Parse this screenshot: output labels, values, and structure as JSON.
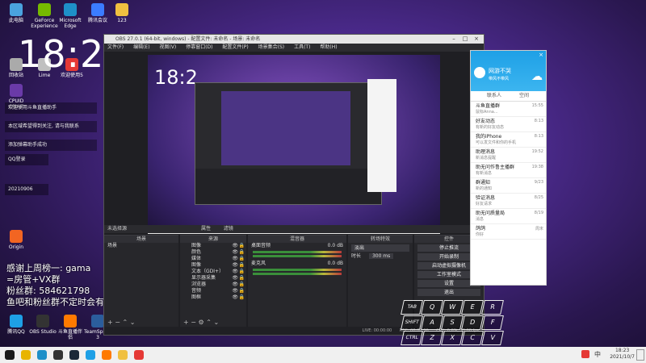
{
  "desktop": {
    "icons": [
      {
        "label": "此电脑",
        "color": "#4aa3df"
      },
      {
        "label": "GeForce Experience",
        "color": "#76b900"
      },
      {
        "label": "Microsoft Edge",
        "color": "#1e90c8"
      },
      {
        "label": "腾讯会议",
        "color": "#3b7cff"
      },
      {
        "label": "123",
        "color": "#f0c040"
      },
      {
        "label": "回收站",
        "color": "#aaaaaa"
      },
      {
        "label": "CPUID CPU-Z",
        "color": "#6a3aa8"
      },
      {
        "label": "Lime",
        "color": "#c0c0c0"
      },
      {
        "label": "欢迎使用5",
        "color": "#e53935"
      },
      {
        "label": "Origin",
        "color": "#f26522"
      },
      {
        "label": "腾讯QQ",
        "color": "#1ea0e6"
      },
      {
        "label": "OBS Studio",
        "color": "#333333"
      },
      {
        "label": "斗鱼直播伴侣",
        "color": "#ff7a00"
      },
      {
        "label": "TeamSpeak 3",
        "color": "#2b5d9c"
      }
    ],
    "big_clock": "18:2",
    "notifications": [
      "欢迎使用斗鱼直播助手",
      "本区域希望得到关注, 请与我联系",
      "添加弹幕助手成功",
      "QQ登录",
      "20210906"
    ],
    "overlay_lines": [
      "感谢上周榜一: gama",
      "=房管+VX群",
      "粉丝群: 584621798",
      "鱼吧和粉丝群不定时会有教学视频和天赋"
    ]
  },
  "obs": {
    "title": "OBS 27.0.1 (64-bit, windows) - 配置文件: 未命名 - 场景: 未命名",
    "menu": [
      "文件(F)",
      "编辑(E)",
      "视图(V)",
      "停靠窗口(D)",
      "配置文件(P)",
      "场景集合(S)",
      "工具(T)",
      "帮助(H)"
    ],
    "source_toolbar": {
      "no_source": "未选择源",
      "properties": "属性",
      "filters": "滤镜"
    },
    "docks": {
      "scenes": {
        "title": "场景",
        "items": [
          "场景"
        ]
      },
      "sources": {
        "title": "来源",
        "items": [
          "图像",
          "颜色",
          "媒体",
          "图像",
          "文本（GDI+）",
          "显示器采集",
          "浏览器",
          "音频",
          "图框"
        ]
      },
      "mixer": {
        "title": "混音器",
        "tracks": [
          {
            "name": "桌面音频",
            "db": "0.0 dB"
          },
          {
            "name": "麦克风",
            "db": "0.0 dB"
          }
        ]
      },
      "transitions": {
        "title": "转场特效",
        "type": "淡出",
        "duration_label": "时长",
        "duration": "300 ms"
      },
      "controls": {
        "title": "控件",
        "buttons": [
          "停止推流",
          "开始录制",
          "启动虚拟摄像机",
          "工作室模式",
          "设置",
          "退出"
        ]
      }
    },
    "status": {
      "live": "LIVE: 00:00:00",
      "rec": "REC: 00:00:00",
      "cpu": "CPU: 0.0%, 30.00 fps"
    }
  },
  "qq": {
    "name": "网游不哭",
    "signature": "带风不带风",
    "tabs": [
      "联系人",
      "空间"
    ],
    "chats": [
      {
        "title": "斗鱼直播群",
        "msg": "鼠标Anna...",
        "time": "15:55"
      },
      {
        "title": "好友动态",
        "msg": "有新的好友动态",
        "time": "8:13"
      },
      {
        "title": "我的iPhone",
        "msg": "可以发文件和你的手机",
        "time": "8:13"
      },
      {
        "title": "助理消息",
        "msg": "新消息提醒",
        "time": "19:52"
      },
      {
        "title": "助无问作鲁主播群",
        "msg": "有新消息",
        "time": "19:38"
      },
      {
        "title": "群通知",
        "msg": "新的通知",
        "time": "9/23"
      },
      {
        "title": "验证消息",
        "msg": "好友请求",
        "time": "8/25"
      },
      {
        "title": "助无问质量局",
        "msg": "消息",
        "time": "8/19"
      },
      {
        "title": "鸽鸽",
        "msg": "你好",
        "time": "周末"
      }
    ]
  },
  "keyboard": {
    "row1": [
      "TAB",
      "Q",
      "W",
      "E",
      "R"
    ],
    "row2": [
      "SHIFT",
      "A",
      "S",
      "D",
      "F"
    ],
    "row3": [
      "CTRL",
      "Z",
      "X",
      "C",
      "V"
    ]
  },
  "taskbar": {
    "apps": [
      {
        "name": "start-icon",
        "color": "#1a1a1a"
      },
      {
        "name": "chrome-icon",
        "color": "#e8b400"
      },
      {
        "name": "edge-icon",
        "color": "#1e90c8"
      },
      {
        "name": "obs-icon",
        "color": "#333333"
      },
      {
        "name": "steam-icon",
        "color": "#1b2838"
      },
      {
        "name": "qq-icon",
        "color": "#1ea0e6"
      },
      {
        "name": "douyu-icon",
        "color": "#ff7a00"
      },
      {
        "name": "folder-icon",
        "color": "#f0c040"
      },
      {
        "name": "red-app-icon",
        "color": "#e53935"
      }
    ],
    "time": "18:23",
    "date": "2021/10/7",
    "ime": "中"
  }
}
